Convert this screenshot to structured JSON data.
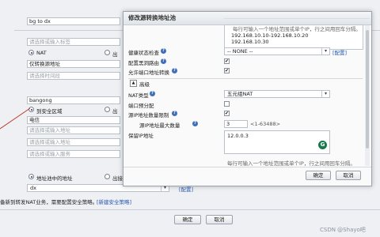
{
  "background": {
    "name_value": "bg to dx",
    "tag_placeholder": "请选择或输入标签",
    "nat_label": "NAT",
    "out_label": "出",
    "schedule_label": "仅转换源地址",
    "time_placeholder": "请选择时间段",
    "source_zone_value": "bangong",
    "security_zone_label": "到安全区域",
    "out2_label": "出",
    "telecom_value": "电信",
    "address_placeholder_1": "请选择或输入地址",
    "address_placeholder_2": "请选择或输入地址",
    "service_placeholder": "请选择或输入服务",
    "addr_pool_label": "地址池中的地址",
    "out3_label": "出接",
    "pool_select_value": "dx",
    "pool_config_link": "[配置]",
    "policy_note": "备新到转发NAT业务，需要配置安全策略。",
    "policy_link": "[新建安全策略]",
    "ok_button": "确定",
    "cancel_button": "取消",
    "watermark": "CSDN @Shayo吧"
  },
  "modal": {
    "title": "修改源转换地址池",
    "ip_hint_top": "每行可输入一个地址范围或单个IP，行之间用回车分隔。",
    "ip_lines": [
      "192.168.10.10-192.168.10.20",
      "192.168.10.30"
    ],
    "health_label": "健康状态检查",
    "health_value": "-- NONE --",
    "health_config_link": "[配置]",
    "blackhole_label": "配置黑洞路由",
    "allow_port_label": "允许端口地址转换",
    "advanced_label": "高级",
    "advanced_toggle": "▲",
    "nat_type_label": "NAT类型",
    "nat_type_value": "五元组NAT",
    "port_prealloc_label": "端口预分配",
    "ip_limit_label": "源IP地址数量限制",
    "ip_limit_max_label": "源IP地址最大数量",
    "ip_limit_max_value": "3",
    "ip_limit_range": "<1-63488>",
    "reserved_ip_label": "保留IP地址",
    "reserved_ip_value": "12.0.0.3",
    "ip_hint_bottom": "每行可输入一个地址范围或单个IP，行之间用回车分隔。",
    "ok_button": "确定",
    "cancel_button": "取消"
  },
  "icons": {
    "help": "help-icon",
    "dropdown": "chevron-down-icon",
    "grammarly": "grammarly-icon",
    "collapse": "collapse-icon"
  },
  "colors": {
    "help_blue": "#3e6fb8",
    "link_blue": "#2457b5",
    "grammarly_green": "#18794e"
  }
}
